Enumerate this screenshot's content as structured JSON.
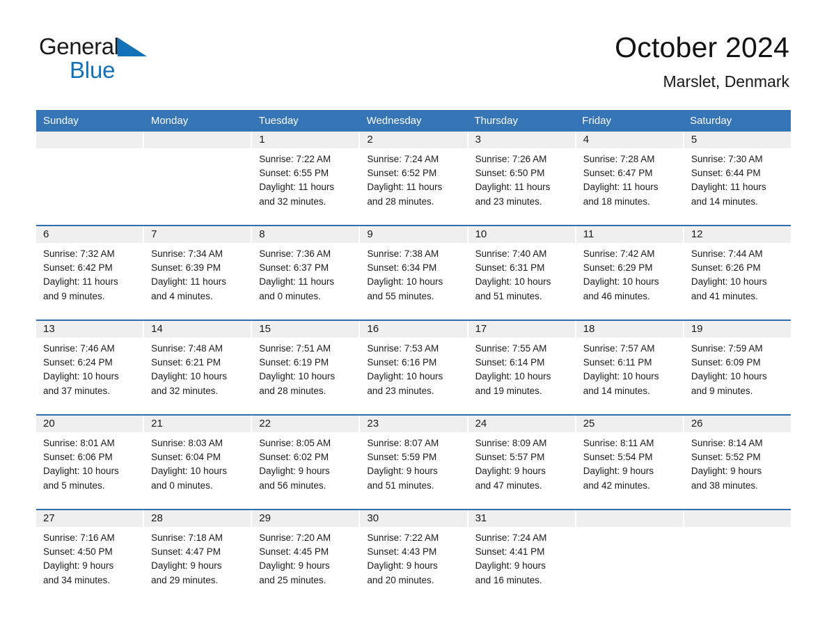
{
  "brand": {
    "name_part1": "General",
    "name_part2": "Blue",
    "accent_color": "#1272b8"
  },
  "header": {
    "title": "October 2024",
    "location": "Marslet, Denmark"
  },
  "theme": {
    "header_blue": "#3575b5",
    "row_divider_blue": "#2e6fae",
    "daynum_band": "#efefef"
  },
  "calendar": {
    "weekdays": [
      "Sunday",
      "Monday",
      "Tuesday",
      "Wednesday",
      "Thursday",
      "Friday",
      "Saturday"
    ],
    "weeks": [
      [
        {
          "day": "",
          "lines": []
        },
        {
          "day": "",
          "lines": []
        },
        {
          "day": "1",
          "lines": [
            "Sunrise: 7:22 AM",
            "Sunset: 6:55 PM",
            "Daylight: 11 hours",
            "and 32 minutes."
          ]
        },
        {
          "day": "2",
          "lines": [
            "Sunrise: 7:24 AM",
            "Sunset: 6:52 PM",
            "Daylight: 11 hours",
            "and 28 minutes."
          ]
        },
        {
          "day": "3",
          "lines": [
            "Sunrise: 7:26 AM",
            "Sunset: 6:50 PM",
            "Daylight: 11 hours",
            "and 23 minutes."
          ]
        },
        {
          "day": "4",
          "lines": [
            "Sunrise: 7:28 AM",
            "Sunset: 6:47 PM",
            "Daylight: 11 hours",
            "and 18 minutes."
          ]
        },
        {
          "day": "5",
          "lines": [
            "Sunrise: 7:30 AM",
            "Sunset: 6:44 PM",
            "Daylight: 11 hours",
            "and 14 minutes."
          ]
        }
      ],
      [
        {
          "day": "6",
          "lines": [
            "Sunrise: 7:32 AM",
            "Sunset: 6:42 PM",
            "Daylight: 11 hours",
            "and 9 minutes."
          ]
        },
        {
          "day": "7",
          "lines": [
            "Sunrise: 7:34 AM",
            "Sunset: 6:39 PM",
            "Daylight: 11 hours",
            "and 4 minutes."
          ]
        },
        {
          "day": "8",
          "lines": [
            "Sunrise: 7:36 AM",
            "Sunset: 6:37 PM",
            "Daylight: 11 hours",
            "and 0 minutes."
          ]
        },
        {
          "day": "9",
          "lines": [
            "Sunrise: 7:38 AM",
            "Sunset: 6:34 PM",
            "Daylight: 10 hours",
            "and 55 minutes."
          ]
        },
        {
          "day": "10",
          "lines": [
            "Sunrise: 7:40 AM",
            "Sunset: 6:31 PM",
            "Daylight: 10 hours",
            "and 51 minutes."
          ]
        },
        {
          "day": "11",
          "lines": [
            "Sunrise: 7:42 AM",
            "Sunset: 6:29 PM",
            "Daylight: 10 hours",
            "and 46 minutes."
          ]
        },
        {
          "day": "12",
          "lines": [
            "Sunrise: 7:44 AM",
            "Sunset: 6:26 PM",
            "Daylight: 10 hours",
            "and 41 minutes."
          ]
        }
      ],
      [
        {
          "day": "13",
          "lines": [
            "Sunrise: 7:46 AM",
            "Sunset: 6:24 PM",
            "Daylight: 10 hours",
            "and 37 minutes."
          ]
        },
        {
          "day": "14",
          "lines": [
            "Sunrise: 7:48 AM",
            "Sunset: 6:21 PM",
            "Daylight: 10 hours",
            "and 32 minutes."
          ]
        },
        {
          "day": "15",
          "lines": [
            "Sunrise: 7:51 AM",
            "Sunset: 6:19 PM",
            "Daylight: 10 hours",
            "and 28 minutes."
          ]
        },
        {
          "day": "16",
          "lines": [
            "Sunrise: 7:53 AM",
            "Sunset: 6:16 PM",
            "Daylight: 10 hours",
            "and 23 minutes."
          ]
        },
        {
          "day": "17",
          "lines": [
            "Sunrise: 7:55 AM",
            "Sunset: 6:14 PM",
            "Daylight: 10 hours",
            "and 19 minutes."
          ]
        },
        {
          "day": "18",
          "lines": [
            "Sunrise: 7:57 AM",
            "Sunset: 6:11 PM",
            "Daylight: 10 hours",
            "and 14 minutes."
          ]
        },
        {
          "day": "19",
          "lines": [
            "Sunrise: 7:59 AM",
            "Sunset: 6:09 PM",
            "Daylight: 10 hours",
            "and 9 minutes."
          ]
        }
      ],
      [
        {
          "day": "20",
          "lines": [
            "Sunrise: 8:01 AM",
            "Sunset: 6:06 PM",
            "Daylight: 10 hours",
            "and 5 minutes."
          ]
        },
        {
          "day": "21",
          "lines": [
            "Sunrise: 8:03 AM",
            "Sunset: 6:04 PM",
            "Daylight: 10 hours",
            "and 0 minutes."
          ]
        },
        {
          "day": "22",
          "lines": [
            "Sunrise: 8:05 AM",
            "Sunset: 6:02 PM",
            "Daylight: 9 hours",
            "and 56 minutes."
          ]
        },
        {
          "day": "23",
          "lines": [
            "Sunrise: 8:07 AM",
            "Sunset: 5:59 PM",
            "Daylight: 9 hours",
            "and 51 minutes."
          ]
        },
        {
          "day": "24",
          "lines": [
            "Sunrise: 8:09 AM",
            "Sunset: 5:57 PM",
            "Daylight: 9 hours",
            "and 47 minutes."
          ]
        },
        {
          "day": "25",
          "lines": [
            "Sunrise: 8:11 AM",
            "Sunset: 5:54 PM",
            "Daylight: 9 hours",
            "and 42 minutes."
          ]
        },
        {
          "day": "26",
          "lines": [
            "Sunrise: 8:14 AM",
            "Sunset: 5:52 PM",
            "Daylight: 9 hours",
            "and 38 minutes."
          ]
        }
      ],
      [
        {
          "day": "27",
          "lines": [
            "Sunrise: 7:16 AM",
            "Sunset: 4:50 PM",
            "Daylight: 9 hours",
            "and 34 minutes."
          ]
        },
        {
          "day": "28",
          "lines": [
            "Sunrise: 7:18 AM",
            "Sunset: 4:47 PM",
            "Daylight: 9 hours",
            "and 29 minutes."
          ]
        },
        {
          "day": "29",
          "lines": [
            "Sunrise: 7:20 AM",
            "Sunset: 4:45 PM",
            "Daylight: 9 hours",
            "and 25 minutes."
          ]
        },
        {
          "day": "30",
          "lines": [
            "Sunrise: 7:22 AM",
            "Sunset: 4:43 PM",
            "Daylight: 9 hours",
            "and 20 minutes."
          ]
        },
        {
          "day": "31",
          "lines": [
            "Sunrise: 7:24 AM",
            "Sunset: 4:41 PM",
            "Daylight: 9 hours",
            "and 16 minutes."
          ]
        },
        {
          "day": "",
          "lines": []
        },
        {
          "day": "",
          "lines": []
        }
      ]
    ]
  }
}
